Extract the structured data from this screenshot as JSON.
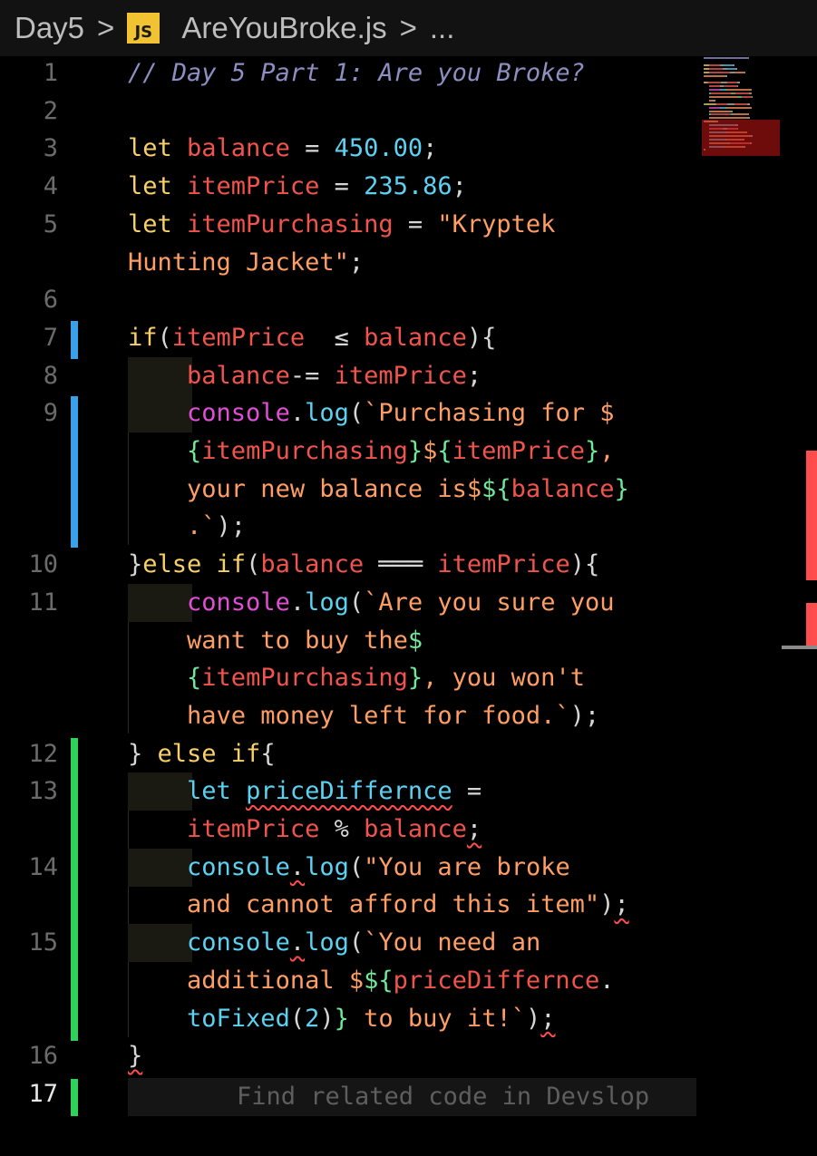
{
  "breadcrumb": {
    "folder": "Day5",
    "sep": ">",
    "file_icon": "JS",
    "file": "AreYouBroke.js",
    "tail": "..."
  },
  "editor": {
    "lines": [
      {
        "n": "1",
        "segs": [
          [
            "cm",
            "// Day 5 Part 1: Are you Broke?"
          ]
        ]
      },
      {
        "n": "2",
        "segs": []
      },
      {
        "n": "3",
        "segs": [
          [
            "kw",
            "let "
          ],
          [
            "vr",
            "balance"
          ],
          [
            "op",
            " = "
          ],
          [
            "nm",
            "450.00"
          ],
          [
            "op",
            ";"
          ]
        ]
      },
      {
        "n": "4",
        "segs": [
          [
            "kw",
            "let "
          ],
          [
            "vr",
            "itemPrice"
          ],
          [
            "op",
            " = "
          ],
          [
            "nm",
            "235.86"
          ],
          [
            "op",
            ";"
          ]
        ]
      },
      {
        "n": "5",
        "segs": [
          [
            "kw",
            "let "
          ],
          [
            "vr",
            "itemPurchasing"
          ],
          [
            "op",
            " = "
          ],
          [
            "st",
            "\"Kryptek"
          ]
        ]
      },
      {
        "n": "",
        "segs": [
          [
            "st",
            "Hunting Jacket\""
          ],
          [
            "op",
            ";"
          ]
        ]
      },
      {
        "n": "6",
        "segs": []
      },
      {
        "n": "7",
        "segs": [
          [
            "kw",
            "if"
          ],
          [
            "op",
            "("
          ],
          [
            "vr",
            "itemPrice"
          ],
          [
            "op",
            "  ≤ "
          ],
          [
            "vr",
            "balance"
          ],
          [
            "op",
            "){"
          ]
        ]
      },
      {
        "n": "8",
        "segs": [
          [
            "sp",
            "    "
          ],
          [
            "vr",
            "balance"
          ],
          [
            "op",
            "-= "
          ],
          [
            "vr",
            "itemPrice"
          ],
          [
            "op",
            ";"
          ]
        ]
      },
      {
        "n": "9",
        "segs": [
          [
            "sp",
            "    "
          ],
          [
            "fn",
            "console"
          ],
          [
            "op",
            "."
          ],
          [
            "cy",
            "log"
          ],
          [
            "op",
            "("
          ],
          [
            "st",
            "`Purchasing for $"
          ]
        ]
      },
      {
        "n": "",
        "segs": [
          [
            "sp",
            "    "
          ],
          [
            "gr",
            "{"
          ],
          [
            "vr",
            "itemPurchasing"
          ],
          [
            "gr",
            "}"
          ],
          [
            "st",
            "$"
          ],
          [
            "gr",
            "{"
          ],
          [
            "vr",
            "itemPrice"
          ],
          [
            "gr",
            "}"
          ],
          [
            "st",
            ","
          ]
        ]
      },
      {
        "n": "",
        "segs": [
          [
            "sp",
            "    "
          ],
          [
            "st",
            "your new balance is$"
          ],
          [
            "gr",
            "${"
          ],
          [
            "vr",
            "balance"
          ],
          [
            "gr",
            "}"
          ]
        ]
      },
      {
        "n": "",
        "segs": [
          [
            "sp",
            "    "
          ],
          [
            "st",
            ".`"
          ],
          [
            "op",
            ");"
          ]
        ]
      },
      {
        "n": "10",
        "segs": [
          [
            "op",
            "}"
          ],
          [
            "kw",
            "else if"
          ],
          [
            "op",
            "("
          ],
          [
            "vr",
            "balance"
          ],
          [
            "op",
            " ═══ "
          ],
          [
            "vr",
            "itemPrice"
          ],
          [
            "op",
            "){"
          ]
        ]
      },
      {
        "n": "11",
        "segs": [
          [
            "sp",
            "    "
          ],
          [
            "fn",
            "console"
          ],
          [
            "op",
            "."
          ],
          [
            "cy",
            "log"
          ],
          [
            "op",
            "("
          ],
          [
            "st",
            "`Are you sure you"
          ]
        ]
      },
      {
        "n": "",
        "segs": [
          [
            "sp",
            "    "
          ],
          [
            "st",
            "want to buy the"
          ],
          [
            "gr",
            "$"
          ]
        ]
      },
      {
        "n": "",
        "segs": [
          [
            "sp",
            "    "
          ],
          [
            "gr",
            "{"
          ],
          [
            "vr",
            "itemPurchasing"
          ],
          [
            "gr",
            "}"
          ],
          [
            "st",
            ", you won't"
          ]
        ]
      },
      {
        "n": "",
        "segs": [
          [
            "sp",
            "    "
          ],
          [
            "st",
            "have money left for food.`"
          ],
          [
            "op",
            ");"
          ]
        ]
      },
      {
        "n": "12",
        "segs": [
          [
            "op",
            "} "
          ],
          [
            "kw",
            "else if"
          ],
          [
            "op",
            "{"
          ]
        ]
      },
      {
        "n": "13",
        "segs": [
          [
            "sp",
            "    "
          ],
          [
            "cy",
            "let "
          ],
          [
            "cyq",
            "priceDiffernce"
          ],
          [
            "op",
            " ="
          ]
        ]
      },
      {
        "n": "",
        "segs": [
          [
            "sp",
            "    "
          ],
          [
            "vr",
            "itemPrice"
          ],
          [
            "op",
            " % "
          ],
          [
            "vr",
            "balance"
          ],
          [
            "opq",
            ";"
          ]
        ]
      },
      {
        "n": "14",
        "segs": [
          [
            "sp",
            "    "
          ],
          [
            "cy",
            "console"
          ],
          [
            "opq",
            "."
          ],
          [
            "cy",
            "log"
          ],
          [
            "op",
            "("
          ],
          [
            "st",
            "\"You are broke"
          ]
        ]
      },
      {
        "n": "",
        "segs": [
          [
            "sp",
            "    "
          ],
          [
            "st",
            "and cannot afford this item\""
          ],
          [
            "op",
            ")"
          ],
          [
            "opq",
            ";"
          ]
        ]
      },
      {
        "n": "15",
        "segs": [
          [
            "sp",
            "    "
          ],
          [
            "cy",
            "console"
          ],
          [
            "opq",
            "."
          ],
          [
            "cy",
            "log"
          ],
          [
            "op",
            "("
          ],
          [
            "st",
            "`You need an"
          ]
        ]
      },
      {
        "n": "",
        "segs": [
          [
            "sp",
            "    "
          ],
          [
            "st",
            "additional $"
          ],
          [
            "gr",
            "${"
          ],
          [
            "vr",
            "priceDiffernce"
          ],
          [
            "op",
            "."
          ]
        ]
      },
      {
        "n": "",
        "segs": [
          [
            "sp",
            "    "
          ],
          [
            "cy",
            "toFixed"
          ],
          [
            "op",
            "("
          ],
          [
            "nm",
            "2"
          ],
          [
            "op",
            ")"
          ],
          [
            "gr",
            "}"
          ],
          [
            "st",
            " to buy it!`"
          ],
          [
            "op",
            ")"
          ],
          [
            "opq",
            ";"
          ]
        ]
      },
      {
        "n": "16",
        "segs": [
          [
            "opq",
            "}"
          ]
        ]
      },
      {
        "n": "17",
        "segs": []
      }
    ],
    "ghost_text": "Find related code in Devslop"
  },
  "colors": {
    "accent_blue": "#3aa0e8",
    "accent_green": "#30d158",
    "error_red": "#ff4d4d"
  }
}
